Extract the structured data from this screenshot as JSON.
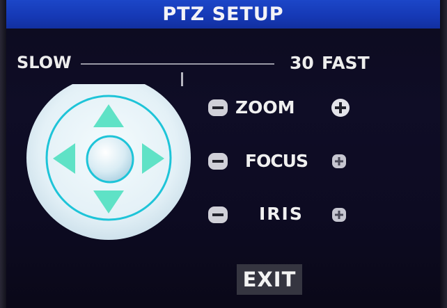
{
  "window": {
    "title": "PTZ SETUP"
  },
  "speed": {
    "min_label": "SLOW",
    "max_label": "FAST",
    "value": "30",
    "level_fraction": 0.52
  },
  "dpad": {
    "up": "up-arrow-icon",
    "down": "down-arrow-icon",
    "left": "left-arrow-icon",
    "right": "right-arrow-icon",
    "center": "center-button"
  },
  "controls": [
    {
      "label": "ZOOM",
      "decrease_icon": "minus-icon",
      "increase_icon": "plus-icon"
    },
    {
      "label": "FOCUS",
      "decrease_icon": "minus-icon",
      "increase_icon": "plus-icon"
    },
    {
      "label": "IRIS",
      "decrease_icon": "minus-icon",
      "increase_icon": "plus-icon"
    }
  ],
  "exit": {
    "label": "EXIT"
  },
  "colors": {
    "title_bar": "#1c46c8",
    "background": "#0f0d26",
    "dpad_disc": "#e6f2f8",
    "dpad_ring": "#1ec4d8",
    "dpad_arrow": "#5fe2c6",
    "button_face": "#d0d0d8",
    "exit_button": "#353540"
  }
}
